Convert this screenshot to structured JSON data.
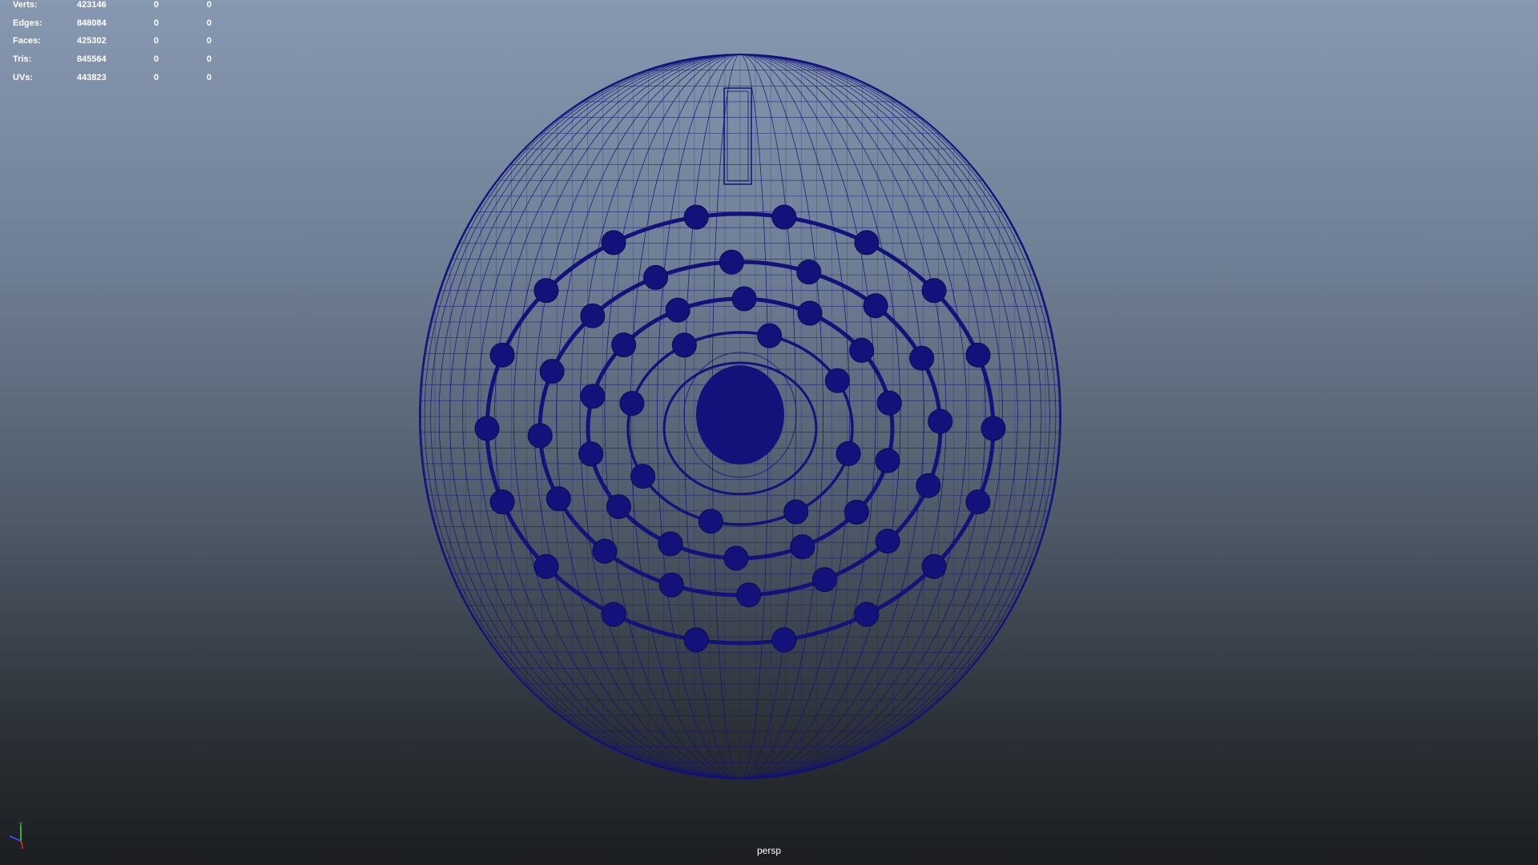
{
  "hud": {
    "stats": [
      {
        "label": "Verts:",
        "total": "423146",
        "selected": "0",
        "component": "0"
      },
      {
        "label": "Edges:",
        "total": "848084",
        "selected": "0",
        "component": "0"
      },
      {
        "label": "Faces:",
        "total": "425302",
        "selected": "0",
        "component": "0"
      },
      {
        "label": "Tris:",
        "total": "845564",
        "selected": "0",
        "component": "0"
      },
      {
        "label": "UVs:",
        "total": "443823",
        "selected": "0",
        "component": "0"
      }
    ]
  },
  "viewport": {
    "camera": "persp",
    "wire_color": "#12127a",
    "axis_labels": {
      "y": "y",
      "x": "x"
    },
    "axis_colors": {
      "x": "#ff2a2a",
      "y": "#3fe03f",
      "z": "#3b5bff"
    }
  }
}
